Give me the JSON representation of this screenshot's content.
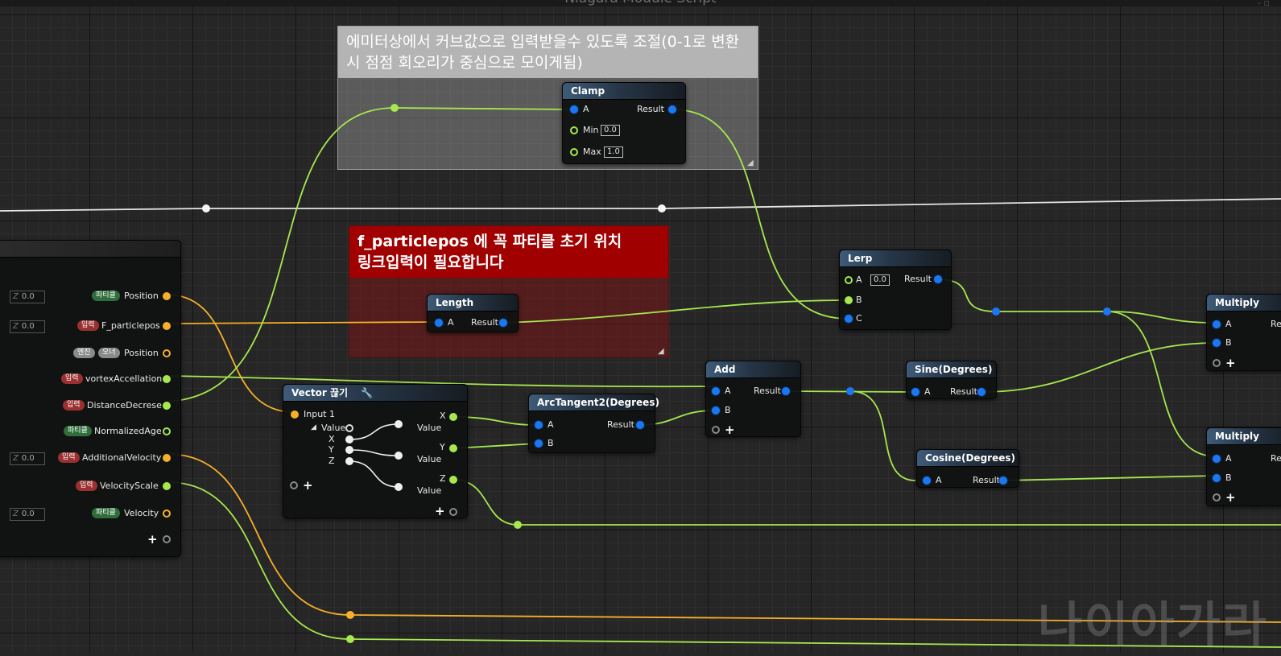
{
  "window": {
    "title": "Niagara Module Script",
    "controls": "- ▫"
  },
  "comments": {
    "clamp_comment": "에미터상에서 커브값으로 입력받을수 있도록 조절(0-1로 변환시 점점 회오리가 중심으로 모이게됨)",
    "length_comment_line1": "f_particlepos 에 꼭 파티클 초기 위치",
    "length_comment_line2": "링크입력이 필요합니다"
  },
  "colors": {
    "float_pin": "#a6e84e",
    "vector_pin": "#f6b02a",
    "wildcard_pin": "#1b78f0",
    "comment_red": "#a00000"
  },
  "input_node": {
    "rows": [
      {
        "badge": "파티클",
        "badge2": "",
        "label": "Position",
        "value": "0.0"
      },
      {
        "badge": "입력",
        "badge2": "",
        "label": "F_particlepos",
        "value": "0.0"
      },
      {
        "badge": "엔진",
        "badge2": "오너",
        "label": "Position",
        "value": ""
      },
      {
        "badge": "입력",
        "badge2": "",
        "label": "vortexAccellation",
        "value": ""
      },
      {
        "badge": "입력",
        "badge2": "",
        "label": "DistanceDecrese",
        "value": ""
      },
      {
        "badge": "파티클",
        "badge2": "",
        "label": "NormalizedAge",
        "value": ""
      },
      {
        "badge": "입력",
        "badge2": "",
        "label": "AdditionalVelocity",
        "value": "0.0"
      },
      {
        "badge": "입력",
        "badge2": "",
        "label": "VelocityScale",
        "value": ""
      },
      {
        "badge": "파티클",
        "badge2": "",
        "label": "Velocity",
        "value": "0.0"
      }
    ],
    "z_label": "Z"
  },
  "nodes": {
    "clamp": {
      "title": "Clamp",
      "a": "A",
      "result": "Result",
      "min": "Min",
      "min_val": "0.0",
      "max": "Max",
      "max_val": "1.0"
    },
    "length": {
      "title": "Length",
      "a": "A",
      "result": "Result"
    },
    "lerp": {
      "title": "Lerp",
      "a": "A",
      "a_val": "0.0",
      "b": "B",
      "c": "C",
      "result": "Result"
    },
    "vector_break": {
      "title": "Vector 끊기",
      "input": "Input 1",
      "value": "Value",
      "x": "X",
      "y": "Y",
      "z": "Z",
      "out_value": "Value"
    },
    "atan2": {
      "title": "ArcTangent2(Degrees)",
      "a": "A",
      "b": "B",
      "result": "Result"
    },
    "add": {
      "title": "Add",
      "a": "A",
      "b": "B",
      "result": "Result"
    },
    "sine": {
      "title": "Sine(Degrees)",
      "a": "A",
      "result": "Result"
    },
    "cosine": {
      "title": "Cosine(Degrees)",
      "a": "A",
      "result": "Result"
    },
    "multiply1": {
      "title": "Multiply",
      "a": "A",
      "b": "B",
      "result": "Re"
    },
    "multiply2": {
      "title": "Multiply",
      "a": "A",
      "b": "B",
      "result": "Re"
    }
  },
  "watermark": "나이아가라"
}
